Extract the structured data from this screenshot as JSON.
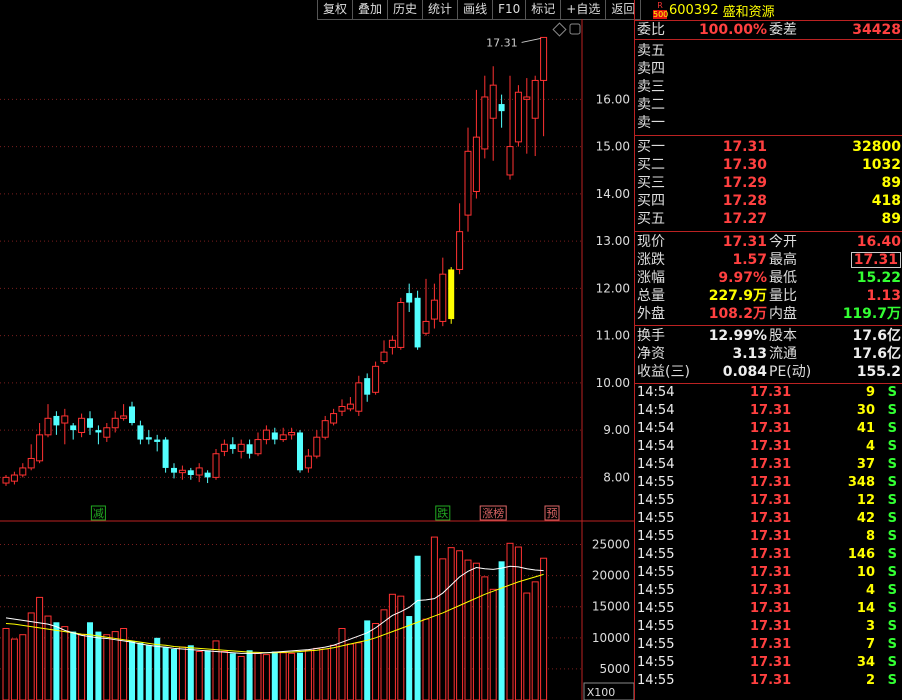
{
  "toolbar": [
    "复权",
    "叠加",
    "历史",
    "统计",
    "画线",
    "F10",
    "标记",
    "+自选",
    "返回"
  ],
  "stock": {
    "badge_r": "R",
    "badge_500": "500",
    "code": "600392",
    "name": "盛和资源"
  },
  "ratio": {
    "label": "委比",
    "value": "100.00%",
    "diff_label": "委差",
    "diff_value": "34428"
  },
  "asks": [
    "卖五",
    "卖四",
    "卖三",
    "卖二",
    "卖一"
  ],
  "bids": [
    {
      "label": "买一",
      "price": "17.31",
      "vol": "32800"
    },
    {
      "label": "买二",
      "price": "17.30",
      "vol": "1032"
    },
    {
      "label": "买三",
      "price": "17.29",
      "vol": "89"
    },
    {
      "label": "买四",
      "price": "17.28",
      "vol": "418"
    },
    {
      "label": "买五",
      "price": "17.27",
      "vol": "89"
    }
  ],
  "quote": {
    "xj": "现价",
    "xj_v": "17.31",
    "jk": "今开",
    "jk_v": "16.40",
    "zd": "涨跌",
    "zd_v": "1.57",
    "zg": "最高",
    "zg_v": "17.31",
    "zf": "涨幅",
    "zf_v": "9.97%",
    "zdi": "最低",
    "zdi_v": "15.22",
    "zl": "总量",
    "zl_v": "227.9万",
    "lb": "量比",
    "lb_v": "1.13",
    "wp": "外盘",
    "wp_v": "108.2万",
    "np": "内盘",
    "np_v": "119.7万",
    "hs": "换手",
    "hs_v": "12.99%",
    "gb": "股本",
    "gb_v": "17.6亿",
    "jz": "净资",
    "jz_v": "3.13",
    "lt": "流通",
    "lt_v": "17.6亿",
    "sy": "收益(三)",
    "sy_v": "0.084",
    "pe": "PE(动)",
    "pe_v": "155.2"
  },
  "ticks": [
    {
      "t": "14:54",
      "p": "17.31",
      "v": "9",
      "s": "S"
    },
    {
      "t": "14:54",
      "p": "17.31",
      "v": "30",
      "s": "S"
    },
    {
      "t": "14:54",
      "p": "17.31",
      "v": "41",
      "s": "S"
    },
    {
      "t": "14:54",
      "p": "17.31",
      "v": "4",
      "s": "S"
    },
    {
      "t": "14:54",
      "p": "17.31",
      "v": "37",
      "s": "S"
    },
    {
      "t": "14:55",
      "p": "17.31",
      "v": "348",
      "s": "S"
    },
    {
      "t": "14:55",
      "p": "17.31",
      "v": "12",
      "s": "S"
    },
    {
      "t": "14:55",
      "p": "17.31",
      "v": "42",
      "s": "S"
    },
    {
      "t": "14:55",
      "p": "17.31",
      "v": "8",
      "s": "S"
    },
    {
      "t": "14:55",
      "p": "17.31",
      "v": "146",
      "s": "S"
    },
    {
      "t": "14:55",
      "p": "17.31",
      "v": "10",
      "s": "S"
    },
    {
      "t": "14:55",
      "p": "17.31",
      "v": "4",
      "s": "S"
    },
    {
      "t": "14:55",
      "p": "17.31",
      "v": "14",
      "s": "S"
    },
    {
      "t": "14:55",
      "p": "17.31",
      "v": "3",
      "s": "S"
    },
    {
      "t": "14:55",
      "p": "17.31",
      "v": "7",
      "s": "S"
    },
    {
      "t": "14:55",
      "p": "17.31",
      "v": "34",
      "s": "S"
    },
    {
      "t": "14:55",
      "p": "17.31",
      "v": "2",
      "s": "S"
    }
  ],
  "chart_data": {
    "type": "candlestick",
    "price_axis": {
      "ticks": [
        8.0,
        9.0,
        10.0,
        11.0,
        12.0,
        13.0,
        14.0,
        15.0,
        16.0
      ],
      "labels": [
        "8.00",
        "9.00",
        "10.00",
        "11.00",
        "12.00",
        "13.00",
        "14.00",
        "15.00",
        "16.00"
      ],
      "range": [
        7.5,
        17.7
      ]
    },
    "volume_axis": {
      "ticks": [
        5000,
        10000,
        15000,
        20000,
        25000
      ],
      "labels": [
        "5000",
        "10000",
        "15000",
        "20000",
        "25000"
      ],
      "range": [
        0,
        27500
      ],
      "unit_label": "X100"
    },
    "high_label": "17.31",
    "event_markers": [
      {
        "index": 11,
        "text": "减",
        "color": "#2a2"
      },
      {
        "index": 52,
        "text": "跌",
        "color": "#2a2"
      },
      {
        "index": 58,
        "text": "涨榜",
        "color": "#d66"
      },
      {
        "index": 65,
        "text": "预",
        "color": "#d66"
      }
    ],
    "candles": [
      [
        7.88,
        8.0,
        8.05,
        7.82
      ],
      [
        7.92,
        8.05,
        8.12,
        7.85
      ],
      [
        8.05,
        8.2,
        8.3,
        8.0
      ],
      [
        8.2,
        8.4,
        8.7,
        8.15
      ],
      [
        8.35,
        8.9,
        9.15,
        8.3
      ],
      [
        8.9,
        9.25,
        9.55,
        8.85
      ],
      [
        9.3,
        9.1,
        9.4,
        8.9
      ],
      [
        9.15,
        9.3,
        9.45,
        8.7
      ],
      [
        9.1,
        9.0,
        9.15,
        8.8
      ],
      [
        8.95,
        9.25,
        9.35,
        8.85
      ],
      [
        9.25,
        9.05,
        9.4,
        8.9
      ],
      [
        9.0,
        8.95,
        9.1,
        8.7
      ],
      [
        8.85,
        9.05,
        9.15,
        8.75
      ],
      [
        9.05,
        9.25,
        9.4,
        8.95
      ],
      [
        9.25,
        9.3,
        9.55,
        9.2
      ],
      [
        9.5,
        9.15,
        9.6,
        9.1
      ],
      [
        9.1,
        8.8,
        9.2,
        8.7
      ],
      [
        8.85,
        8.8,
        9.0,
        8.7
      ],
      [
        8.8,
        8.75,
        8.9,
        8.55
      ],
      [
        8.8,
        8.2,
        8.85,
        8.1
      ],
      [
        8.2,
        8.1,
        8.3,
        7.98
      ],
      [
        8.1,
        8.15,
        8.25,
        7.95
      ],
      [
        8.15,
        8.05,
        8.2,
        7.95
      ],
      [
        8.05,
        8.2,
        8.3,
        7.9
      ],
      [
        8.1,
        8.0,
        8.15,
        7.88
      ],
      [
        8.0,
        8.5,
        8.6,
        7.95
      ],
      [
        8.55,
        8.7,
        8.8,
        8.45
      ],
      [
        8.7,
        8.6,
        8.85,
        8.5
      ],
      [
        8.55,
        8.7,
        8.8,
        8.4
      ],
      [
        8.7,
        8.5,
        8.8,
        8.4
      ],
      [
        8.5,
        8.8,
        8.95,
        8.45
      ],
      [
        8.8,
        9.0,
        9.1,
        8.7
      ],
      [
        8.95,
        8.8,
        9.05,
        8.7
      ],
      [
        8.8,
        8.9,
        9.05,
        8.75
      ],
      [
        8.9,
        8.95,
        9.05,
        8.8
      ],
      [
        8.95,
        8.15,
        9.0,
        8.1
      ],
      [
        8.2,
        8.45,
        8.6,
        8.1
      ],
      [
        8.45,
        8.85,
        9.0,
        8.4
      ],
      [
        8.85,
        9.2,
        9.3,
        8.8
      ],
      [
        9.15,
        9.35,
        9.45,
        9.1
      ],
      [
        9.4,
        9.5,
        9.65,
        9.3
      ],
      [
        9.45,
        9.55,
        9.7,
        9.4
      ],
      [
        9.4,
        10.0,
        10.15,
        9.3
      ],
      [
        10.1,
        9.75,
        10.2,
        9.6
      ],
      [
        9.8,
        10.35,
        10.45,
        9.75
      ],
      [
        10.45,
        10.65,
        10.9,
        10.4
      ],
      [
        10.75,
        10.9,
        11.0,
        10.6
      ],
      [
        10.75,
        11.7,
        11.8,
        10.7
      ],
      [
        11.9,
        11.7,
        12.1,
        11.5
      ],
      [
        11.8,
        10.75,
        11.95,
        10.7
      ],
      [
        11.05,
        11.3,
        12.2,
        11.0
      ],
      [
        11.35,
        11.75,
        12.1,
        11.15
      ],
      [
        11.3,
        12.3,
        12.65,
        11.2
      ],
      [
        11.35,
        12.4,
        12.45,
        11.25
      ],
      [
        12.4,
        13.2,
        13.8,
        12.3
      ],
      [
        13.55,
        14.9,
        15.4,
        13.2
      ],
      [
        14.05,
        15.2,
        16.2,
        13.9
      ],
      [
        14.95,
        16.05,
        16.5,
        14.75
      ],
      [
        15.6,
        16.3,
        16.7,
        14.7
      ],
      [
        15.9,
        15.75,
        16.1,
        15.4
      ],
      [
        14.4,
        15.0,
        16.5,
        14.3
      ],
      [
        15.1,
        16.15,
        16.3,
        15.0
      ],
      [
        16.0,
        16.05,
        16.45,
        14.85
      ],
      [
        15.6,
        16.4,
        16.5,
        14.8
      ],
      [
        16.4,
        17.31,
        17.31,
        15.22
      ]
    ],
    "volumes": [
      11500,
      9800,
      10500,
      14000,
      16500,
      13500,
      12500,
      11800,
      11000,
      10500,
      12500,
      11000,
      10500,
      11000,
      11500,
      9500,
      9200,
      8800,
      10000,
      8500,
      8200,
      8500,
      8800,
      7800,
      8000,
      9500,
      7800,
      7500,
      7000,
      8000,
      7500,
      7300,
      7800,
      7600,
      7500,
      7600,
      8000,
      8300,
      8200,
      8800,
      11500,
      9000,
      9200,
      12800,
      12300,
      14500,
      17000,
      16700,
      13500,
      23200,
      13000,
      26200,
      22700,
      24500,
      24000,
      22500,
      22000,
      19800,
      17800,
      22300,
      25200,
      24600,
      17200,
      19000,
      22800
    ],
    "ma_white": [
      13200,
      13000,
      12800,
      12600,
      12400,
      12200,
      11800,
      11200,
      10800,
      10400,
      10200,
      10000,
      9900,
      9700,
      9500,
      9300,
      9000,
      8800,
      8600,
      8500,
      8300,
      8200,
      8100,
      8000,
      7900,
      7800,
      7700,
      7600,
      7500,
      7500,
      7500,
      7600,
      7700,
      7800,
      7900,
      8000,
      8100,
      8300,
      8500,
      8800,
      9300,
      9800,
      10300,
      10800,
      11600,
      12600,
      13600,
      14200,
      14900,
      16000,
      16100,
      16300,
      17200,
      18500,
      19800,
      20700,
      21300,
      21100,
      21000,
      21200,
      21500,
      21400,
      21100,
      20900,
      20800
    ],
    "ma_yellow": [
      12300,
      12200,
      12000,
      11800,
      11600,
      11400,
      11200,
      11000,
      10800,
      10600,
      10500,
      10300,
      10100,
      9900,
      9700,
      9500,
      9300,
      9100,
      8900,
      8800,
      8600,
      8500,
      8400,
      8300,
      8200,
      8100,
      8000,
      7900,
      7800,
      7700,
      7650,
      7600,
      7600,
      7650,
      7700,
      7800,
      7900,
      8000,
      8200,
      8400,
      8700,
      9000,
      9300,
      9600,
      10000,
      10500,
      11000,
      11500,
      12000,
      12500,
      13000,
      13500,
      14000,
      14600,
      15200,
      15800,
      16400,
      17000,
      17500,
      18000,
      18500,
      19000,
      19400,
      19800,
      20200
    ]
  }
}
